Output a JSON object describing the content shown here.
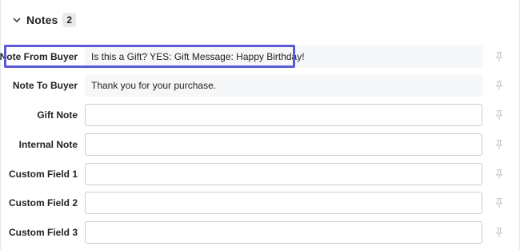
{
  "section": {
    "title": "Notes",
    "count": "2"
  },
  "fields": [
    {
      "label": "Note From Buyer",
      "value": "Is this a Gift? YES: Gift Message: Happy Birthday!"
    },
    {
      "label": "Note To Buyer",
      "value": "Thank you for your purchase."
    },
    {
      "label": "Gift Note",
      "value": ""
    },
    {
      "label": "Internal Note",
      "value": ""
    },
    {
      "label": "Custom Field 1",
      "value": ""
    },
    {
      "label": "Custom Field 2",
      "value": ""
    },
    {
      "label": "Custom Field 3",
      "value": ""
    }
  ],
  "icons": {
    "collapse": "chevron-down-icon",
    "pin": "pin-icon"
  },
  "colors": {
    "highlight": "#5b5bd6",
    "readonly_bg": "#f6f7f8",
    "input_border": "#c9cccf"
  }
}
